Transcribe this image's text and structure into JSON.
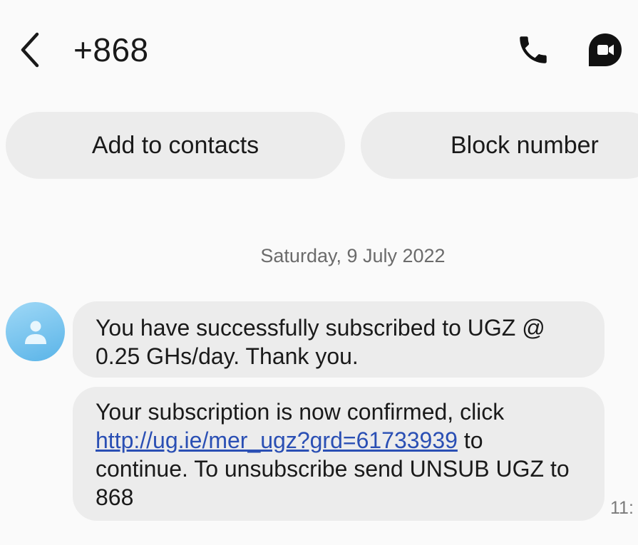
{
  "header": {
    "title": "+868"
  },
  "actions": {
    "add_contact": "Add to contacts",
    "block_number": "Block number"
  },
  "conversation": {
    "date": "Saturday, 9 July 2022",
    "messages": [
      {
        "text": "You have successfully subscribed to UGZ @ 0.25 GHs/day. Thank you."
      },
      {
        "text_before_link": "Your subscription is now confirmed, click ",
        "link": "http://ug.ie/mer_ugz?grd=61733939",
        "text_after_link": " to continue. To unsubscribe send UNSUB UGZ to 868"
      }
    ],
    "time": "11:"
  },
  "icons": {
    "back": "chevron-left-icon",
    "call": "phone-icon",
    "video": "video-call-icon",
    "avatar": "person-icon"
  },
  "colors": {
    "background": "#fafafa",
    "bubble": "#ececec",
    "link": "#2a4fb4",
    "avatar": "#5ab4e8"
  }
}
